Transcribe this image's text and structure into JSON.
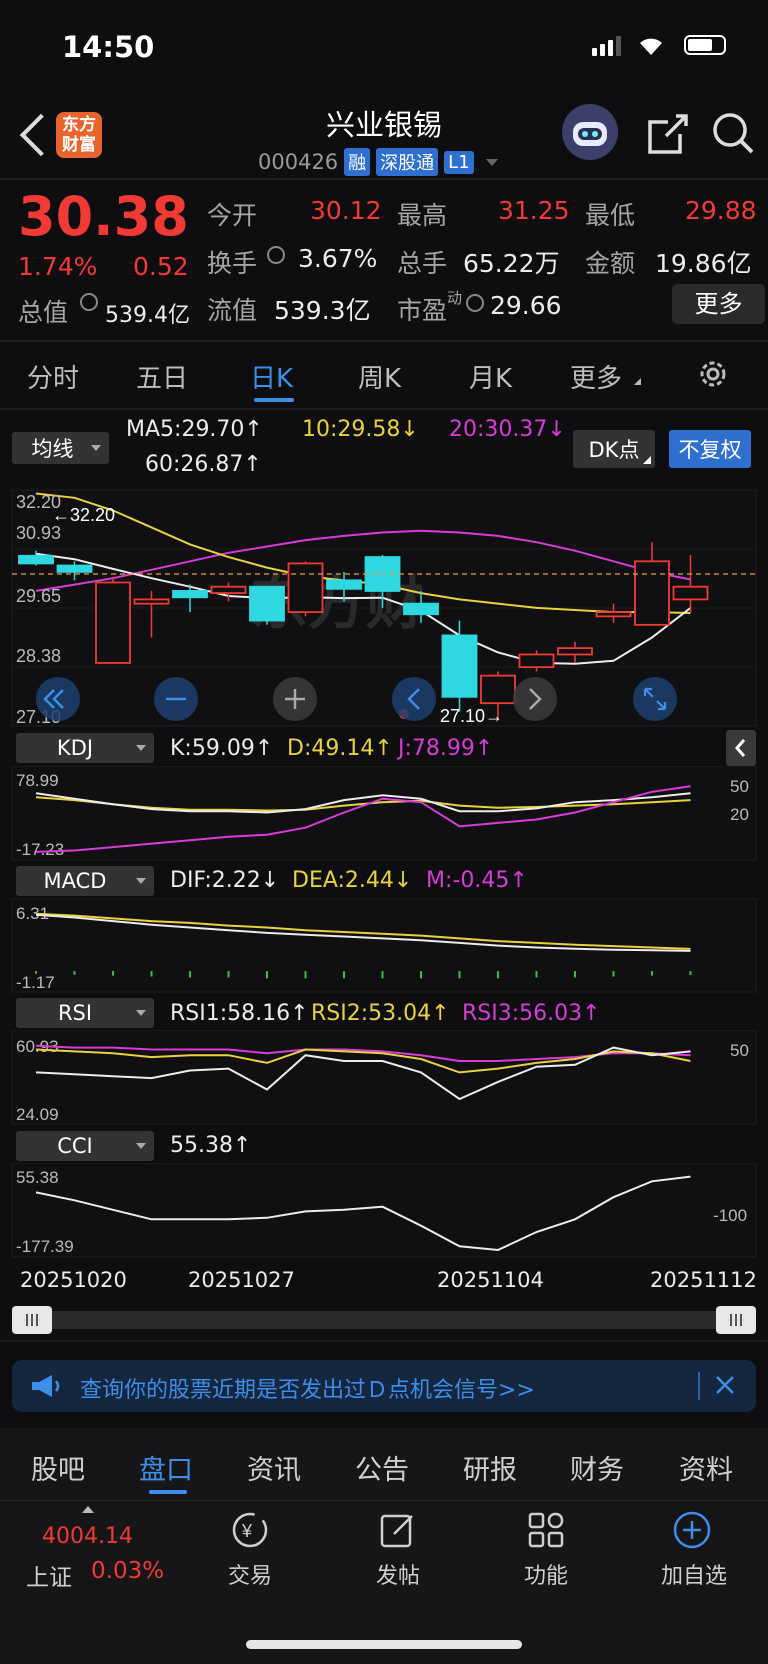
{
  "status_bar": {
    "time": "14:50"
  },
  "header": {
    "logo_text": "东方财富",
    "stock_name": "兴业银锡",
    "code": "000426",
    "tags": [
      "融",
      "深股通",
      "L1"
    ]
  },
  "quote": {
    "price": "30.38",
    "change_pct": "1.74%",
    "change": "0.52",
    "total_value_label": "总值",
    "total_value": "539.4亿",
    "open_label": "今开",
    "open": "30.12",
    "high_label": "最高",
    "high": "31.25",
    "low_label": "最低",
    "low": "29.88",
    "turnover_label": "换手",
    "turnover": "3.67%",
    "volume_label": "总手",
    "volume": "65.22万",
    "amount_label": "金额",
    "amount": "19.86亿",
    "float_label": "流值",
    "float_value": "539.3亿",
    "pe_label": "市盈",
    "pe_sup": "动",
    "pe": "29.66",
    "more_label": "更多"
  },
  "ktabs": [
    "分时",
    "五日",
    "日K",
    "周K",
    "月K",
    "更多"
  ],
  "ma": {
    "select": "均线",
    "ma5": "MA5:29.70↑",
    "ma10": "10:29.58↓",
    "ma20": "20:30.37↓",
    "ma60": "60:26.87↑",
    "dk_label": "DK点",
    "adjust_label": "不复权"
  },
  "main_axis": [
    "32.20",
    "30.93",
    "29.65",
    "28.38",
    "27.10"
  ],
  "marks": {
    "high": "32.20",
    "low": "27.10"
  },
  "watermark": "东方财",
  "kdj": {
    "select": "KDJ",
    "k": "K:59.09↑",
    "d": "D:49.14↑",
    "j": "J:78.99↑",
    "axis_top": "78.99",
    "axis_bottom": "-17.23",
    "r50": "50",
    "r20": "20"
  },
  "macd": {
    "select": "MACD",
    "dif": "DIF:2.22↓",
    "dea": "DEA:2.44↓",
    "m": "M:-0.45↑",
    "axis_top": "6.31",
    "axis_bottom": "-1.17"
  },
  "rsi": {
    "select": "RSI",
    "rsi1": "RSI1:58.16↑",
    "rsi2": "RSI2:53.04↑",
    "rsi3": "RSI3:56.03↑",
    "axis_top": "60.93",
    "axis_bottom": "24.09",
    "r50": "50"
  },
  "cci": {
    "select": "CCI",
    "value": "55.38↑",
    "axis_top": "55.38",
    "axis_bottom": "-177.39",
    "r100": "-100"
  },
  "dates": [
    "20251020",
    "20251027",
    "20251104",
    "20251112"
  ],
  "banner": {
    "text": "查询你的股票近期是否发出过Ｄ点机会信号>>"
  },
  "bottom_tabs": [
    "股吧",
    "盘口",
    "资讯",
    "公告",
    "研报",
    "财务",
    "资料"
  ],
  "nav": {
    "index_value": "4004.14",
    "index_name": "上证",
    "index_pct": "0.03%",
    "trade": "交易",
    "post": "发帖",
    "function": "功能",
    "add_watch": "加自选"
  },
  "colors": {
    "up": "#f23a35",
    "down": "#2fd8e0",
    "accent": "#3d8ee8",
    "ma10": "#e8d33c",
    "ma20": "#d93bd9"
  },
  "candles": [
    {
      "o": 30.93,
      "h": 31.05,
      "l": 30.7,
      "c": 30.75
    },
    {
      "o": 30.7,
      "h": 30.8,
      "l": 30.35,
      "c": 30.55
    },
    {
      "o": 28.4,
      "h": 30.4,
      "l": 28.4,
      "c": 30.3
    },
    {
      "o": 29.8,
      "h": 30.1,
      "l": 29.0,
      "c": 29.9
    },
    {
      "o": 30.1,
      "h": 30.25,
      "l": 29.6,
      "c": 29.95
    },
    {
      "o": 30.05,
      "h": 30.3,
      "l": 29.85,
      "c": 30.2
    },
    {
      "o": 30.2,
      "h": 30.2,
      "l": 29.3,
      "c": 29.4
    },
    {
      "o": 29.6,
      "h": 30.8,
      "l": 29.5,
      "c": 30.75
    },
    {
      "o": 30.35,
      "h": 30.55,
      "l": 29.85,
      "c": 30.15
    },
    {
      "o": 30.9,
      "h": 30.95,
      "l": 29.7,
      "c": 30.1
    },
    {
      "o": 29.8,
      "h": 30.1,
      "l": 29.35,
      "c": 29.55
    },
    {
      "o": 29.05,
      "h": 29.4,
      "l": 27.25,
      "c": 27.6
    },
    {
      "o": 27.45,
      "h": 28.2,
      "l": 27.1,
      "c": 28.1
    },
    {
      "o": 28.3,
      "h": 28.7,
      "l": 28.2,
      "c": 28.6
    },
    {
      "o": 28.6,
      "h": 28.9,
      "l": 28.4,
      "c": 28.75
    },
    {
      "o": 29.5,
      "h": 29.8,
      "l": 29.35,
      "c": 29.6
    },
    {
      "o": 29.3,
      "h": 31.25,
      "l": 29.3,
      "c": 30.8
    },
    {
      "o": 29.9,
      "h": 30.95,
      "l": 29.6,
      "c": 30.2
    }
  ],
  "ma_lines": {
    "ma5": [
      30.98,
      30.85,
      30.62,
      30.4,
      30.2,
      29.98,
      29.93,
      29.95,
      29.93,
      29.94,
      29.63,
      29.05,
      28.65,
      28.4,
      28.38,
      28.45,
      29.0,
      29.7
    ],
    "ma10": [
      32.4,
      32.3,
      32.0,
      31.6,
      31.2,
      30.9,
      30.65,
      30.45,
      30.35,
      30.25,
      30.05,
      29.9,
      29.8,
      29.7,
      29.65,
      29.6,
      29.6,
      29.58
    ],
    "ma20": [
      30.1,
      30.25,
      30.4,
      30.6,
      30.8,
      31.0,
      31.15,
      31.3,
      31.4,
      31.48,
      31.52,
      31.48,
      31.4,
      31.25,
      31.05,
      30.8,
      30.55,
      30.37
    ]
  },
  "kdj_lines": {
    "k": [
      68,
      60,
      52,
      45,
      42,
      42,
      40,
      45,
      58,
      65,
      60,
      42,
      42,
      46,
      55,
      58,
      62,
      68
    ],
    "d": [
      62,
      58,
      52,
      47,
      44,
      44,
      43,
      44,
      50,
      55,
      57,
      50,
      47,
      48,
      50,
      52,
      55,
      58
    ],
    "j": [
      -17,
      -15,
      -10,
      -5,
      0,
      5,
      8,
      18,
      40,
      60,
      55,
      20,
      25,
      30,
      40,
      55,
      70,
      78
    ]
  },
  "macd_lines": {
    "dif": [
      6.2,
      5.9,
      5.5,
      5.1,
      4.8,
      4.5,
      4.2,
      4.0,
      3.8,
      3.6,
      3.4,
      3.1,
      2.8,
      2.6,
      2.45,
      2.35,
      2.3,
      2.22
    ],
    "dea": [
      6.3,
      6.1,
      5.8,
      5.5,
      5.3,
      5.0,
      4.8,
      4.5,
      4.3,
      4.1,
      3.9,
      3.6,
      3.3,
      3.1,
      2.9,
      2.75,
      2.6,
      2.44
    ],
    "m": [
      -0.3,
      -0.4,
      -0.5,
      -0.6,
      -0.7,
      -0.7,
      -0.8,
      -0.8,
      -0.8,
      -0.8,
      -0.8,
      -0.8,
      -0.8,
      -0.7,
      -0.7,
      -0.6,
      -0.5,
      -0.45
    ]
  },
  "rsi_lines": {
    "rsi1": [
      47,
      46,
      45,
      44,
      48,
      49,
      38,
      56,
      53,
      53,
      47,
      33,
      42,
      50,
      51,
      60,
      56,
      58
    ],
    "rsi2": [
      59,
      58,
      57,
      55,
      56,
      56,
      52,
      59,
      58,
      57,
      54,
      47,
      49,
      52,
      54,
      58,
      57,
      53
    ],
    "rsi3": [
      61,
      60,
      60,
      59,
      59,
      59,
      57,
      59,
      59,
      58,
      56,
      53,
      53,
      54,
      55,
      57,
      57,
      56
    ]
  },
  "cci_lines": [
    5,
    -20,
    -50,
    -80,
    -80,
    -80,
    -75,
    -55,
    -50,
    -40,
    -100,
    -165,
    -177,
    -120,
    -80,
    -10,
    40,
    55
  ]
}
